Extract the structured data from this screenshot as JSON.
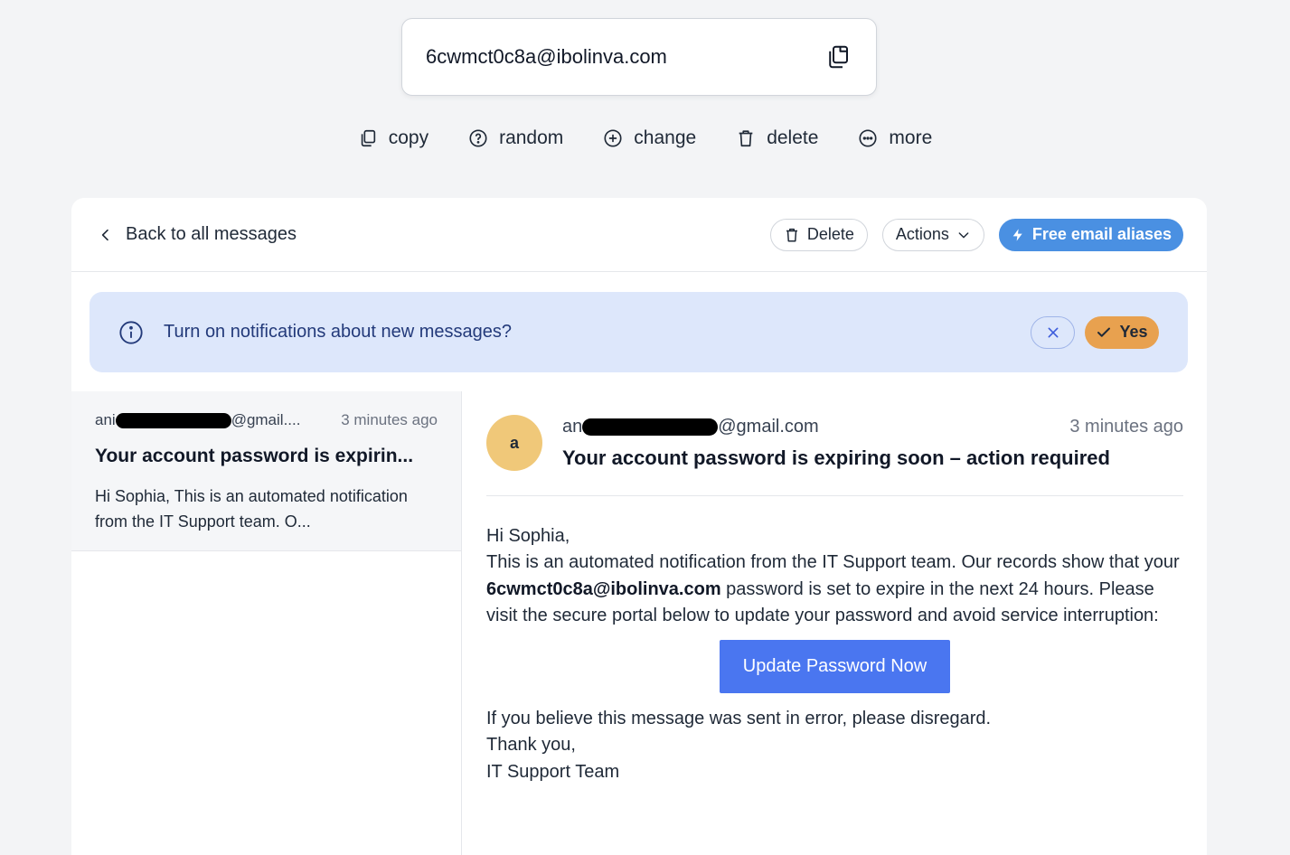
{
  "address": {
    "value": "6cwmct0c8a@ibolinva.com"
  },
  "toolbar": {
    "copy": "copy",
    "random": "random",
    "change": "change",
    "delete": "delete",
    "more": "more"
  },
  "header": {
    "back": "Back to all messages",
    "delete": "Delete",
    "actions": "Actions",
    "aliases": "Free email aliases"
  },
  "notice": {
    "text": "Turn on notifications about new messages?",
    "yes": "Yes"
  },
  "list": {
    "items": [
      {
        "sender_prefix": "ani",
        "sender_suffix": "@gmail....",
        "time": "3 minutes ago",
        "subject": "Your account password is expirin...",
        "preview": "Hi Sophia, This is an automated notification from the IT Support team. O..."
      }
    ]
  },
  "message": {
    "avatar": "a",
    "sender_prefix": "an",
    "sender_suffix": "@gmail.com",
    "time": "3 minutes ago",
    "subject": "Your account password is expiring soon – action required",
    "greeting": "Hi Sophia,",
    "p1": "This is an automated notification from the IT Support team. Our records show that your",
    "p1_email": "6cwmct0c8a@ibolinva.com",
    "p1_rest": "password is set to expire in the next 24 hours. Please visit the secure portal below to update your password and avoid service interruption:",
    "cta": "Update Password Now",
    "closing1": "If you believe this message was sent in error, please disregard.",
    "closing2": "Thank you,",
    "closing3": "IT Support Team"
  },
  "colors": {
    "accent": "#4a90e2",
    "cta": "#4a76f0",
    "notice_bg": "#dde7fb",
    "yes_btn": "#e8a14f",
    "avatar": "#f0c879"
  }
}
